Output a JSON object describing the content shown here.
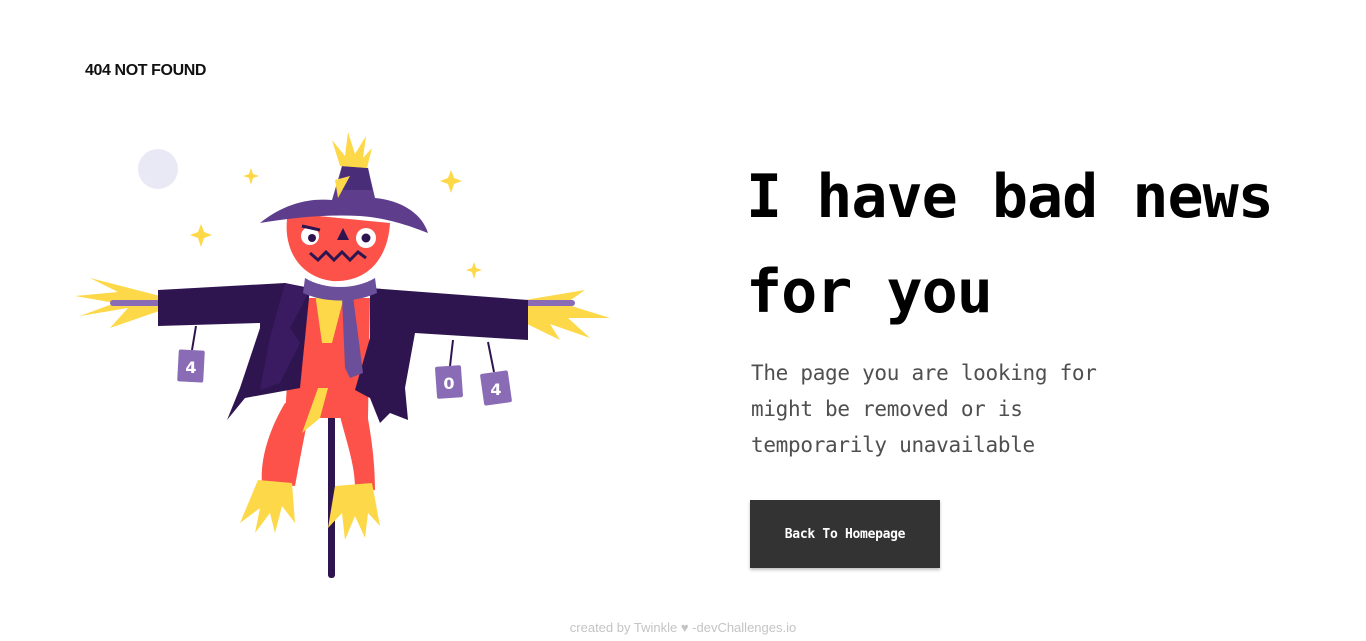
{
  "brand": {
    "title": "404 NOT FOUND"
  },
  "hero": {
    "headline": "I have bad news for you",
    "message": "The page you are looking for might be removed or is temporarily unavailable",
    "button_label": "Back To Homepage"
  },
  "illustration": {
    "can_labels": [
      "4",
      "0",
      "4"
    ]
  },
  "footer": {
    "text": "created by Twinkle ♥ -devChallenges.io"
  },
  "colors": {
    "background": "#ffffff",
    "button": "#333333",
    "button_text": "#ffffff",
    "message_text": "#4f4f4f",
    "footer_text": "#c4c4c4",
    "coat": "#2f1550",
    "hat": "#5d3d8c",
    "face": "#fc5249",
    "straw": "#fdd848",
    "can": "#8a6bb5"
  }
}
